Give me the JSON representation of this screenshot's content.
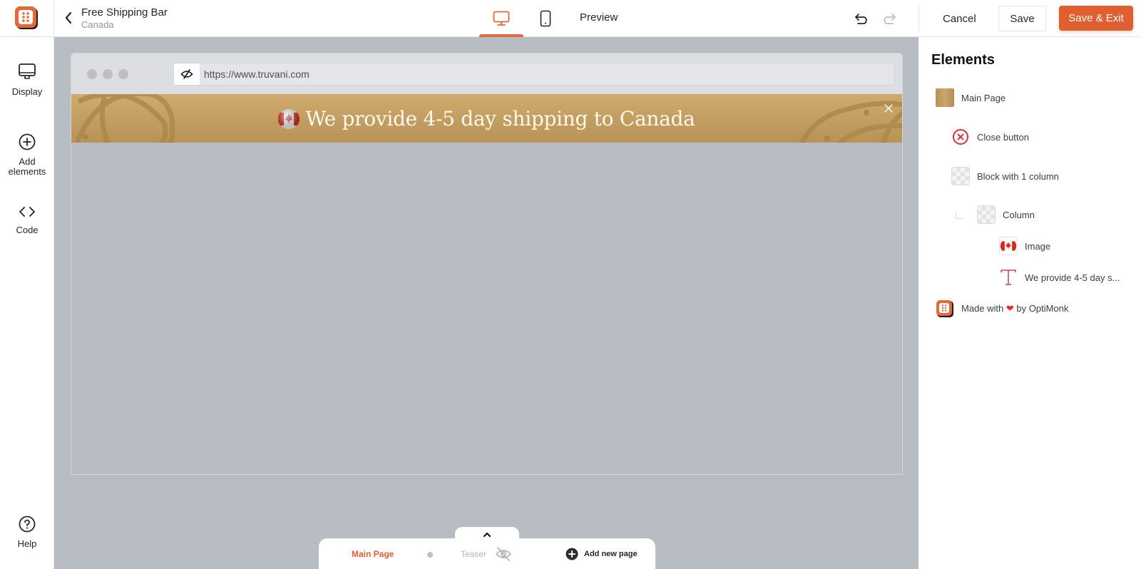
{
  "header": {
    "title": "Free Shipping Bar",
    "subtitle": "Canada",
    "devices": [
      {
        "name": "desktop",
        "icon": "desktop-icon",
        "active": true
      },
      {
        "name": "mobile",
        "icon": "mobile-icon",
        "active": false
      }
    ],
    "preview_label": "Preview",
    "cancel_label": "Cancel",
    "save_label": "Save",
    "save_exit_label": "Save & Exit",
    "accent_color": "#e05f30"
  },
  "sidebar": {
    "items": [
      {
        "label": "Display",
        "icon": "monitor-icon"
      },
      {
        "label": "Add elements",
        "icon": "plus-circle-icon"
      },
      {
        "label": "Code",
        "icon": "code-icon"
      }
    ],
    "help_label": "Help"
  },
  "canvas": {
    "url": "https://www.truvani.com",
    "bar_text": "We provide 4-5 day shipping to Canada",
    "bar_colors": [
      "#cfab6e",
      "#b89257"
    ]
  },
  "pages": {
    "main_label": "Main Page",
    "teaser_label": "Teaser",
    "add_label": "Add new page"
  },
  "elements_panel": {
    "title": "Elements",
    "items": [
      {
        "label": "Main Page",
        "icon": "page-swatch-icon",
        "level": 0
      },
      {
        "label": "Close button",
        "icon": "close-circle-icon",
        "level": 1
      },
      {
        "label": "Block with 1 column",
        "icon": "block-icon",
        "level": 1
      },
      {
        "label": "Column",
        "icon": "column-icon",
        "level": 2
      },
      {
        "label": "Image",
        "icon": "canada-flag-icon",
        "level": 3
      },
      {
        "label": "We provide 4-5 day s...",
        "icon": "text-icon",
        "level": 3
      }
    ],
    "branding": {
      "prefix": "Made with",
      "heart": "❤",
      "suffix": "by OptiMonk"
    }
  }
}
